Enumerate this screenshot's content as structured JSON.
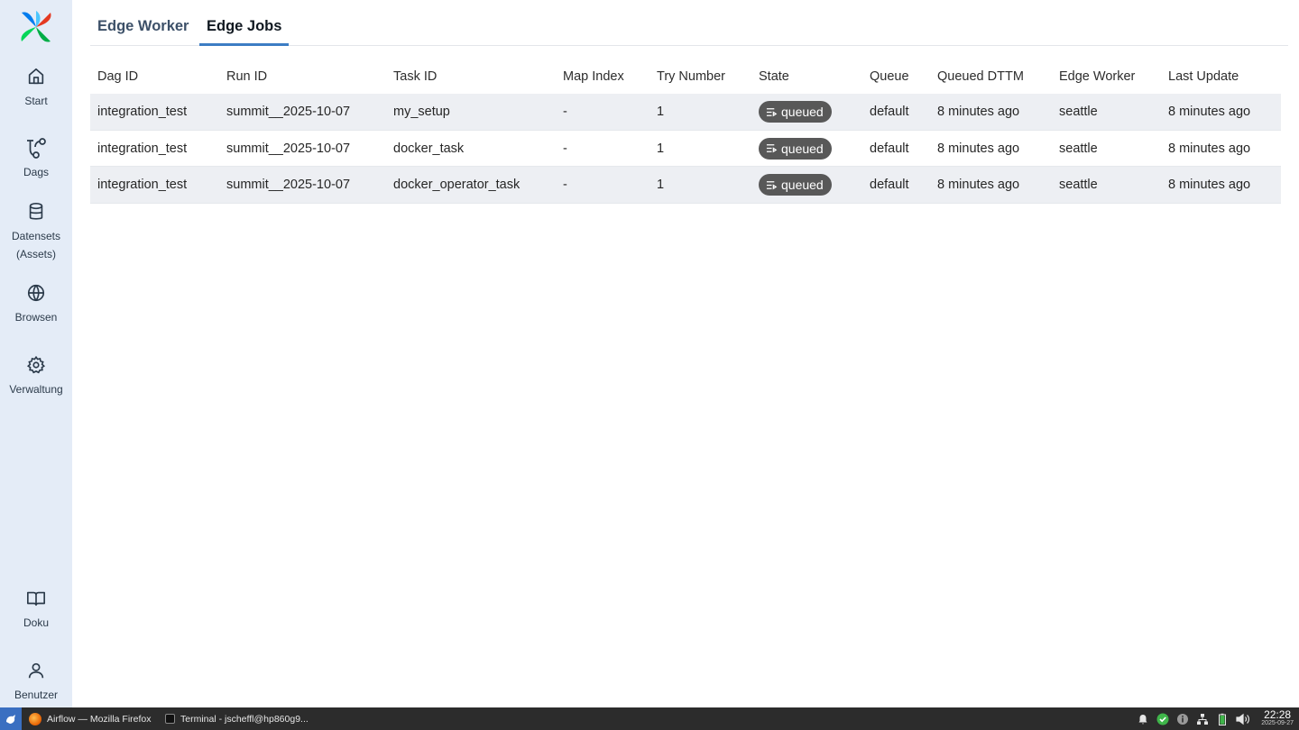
{
  "sidebar": {
    "items": [
      {
        "label": "Start",
        "icon": "home-icon"
      },
      {
        "label": "Dags",
        "icon": "dags-icon"
      },
      {
        "label": "Datensets (Assets)",
        "icon": "database-icon"
      },
      {
        "label": "Browsen",
        "icon": "globe-icon"
      },
      {
        "label": "Verwaltung",
        "icon": "gear-icon"
      },
      {
        "label": "Doku",
        "icon": "book-icon"
      },
      {
        "label": "Benutzer",
        "icon": "user-icon"
      }
    ]
  },
  "tabs": [
    {
      "label": "Edge Worker",
      "active": false
    },
    {
      "label": "Edge Jobs",
      "active": true
    }
  ],
  "table": {
    "headers": [
      "Dag ID",
      "Run ID",
      "Task ID",
      "Map Index",
      "Try Number",
      "State",
      "Queue",
      "Queued DTTM",
      "Edge Worker",
      "Last Update"
    ],
    "rows": [
      [
        "integration_test",
        "summit__2025-10-07",
        "my_setup",
        "-",
        "1",
        "queued",
        "default",
        "8 minutes ago",
        "seattle",
        "8 minutes ago"
      ],
      [
        "integration_test",
        "summit__2025-10-07",
        "docker_task",
        "-",
        "1",
        "queued",
        "default",
        "8 minutes ago",
        "seattle",
        "8 minutes ago"
      ],
      [
        "integration_test",
        "summit__2025-10-07",
        "docker_operator_task",
        "-",
        "1",
        "queued",
        "default",
        "8 minutes ago",
        "seattle",
        "8 minutes ago"
      ]
    ]
  },
  "taskbar": {
    "tasks": [
      {
        "label": "Airflow — Mozilla Firefox",
        "icon": "firefox-icon"
      },
      {
        "label": "Terminal - jscheffl@hp860g9...",
        "icon": "terminal-icon"
      }
    ],
    "clock_time": "22:28",
    "clock_date": "2025-09-27"
  },
  "colors": {
    "sidebar_bg": "#e4ecf7",
    "active_tab_underline": "#3c7dc4",
    "queued_badge": "#585858",
    "row_stripe": "#edeff3"
  }
}
